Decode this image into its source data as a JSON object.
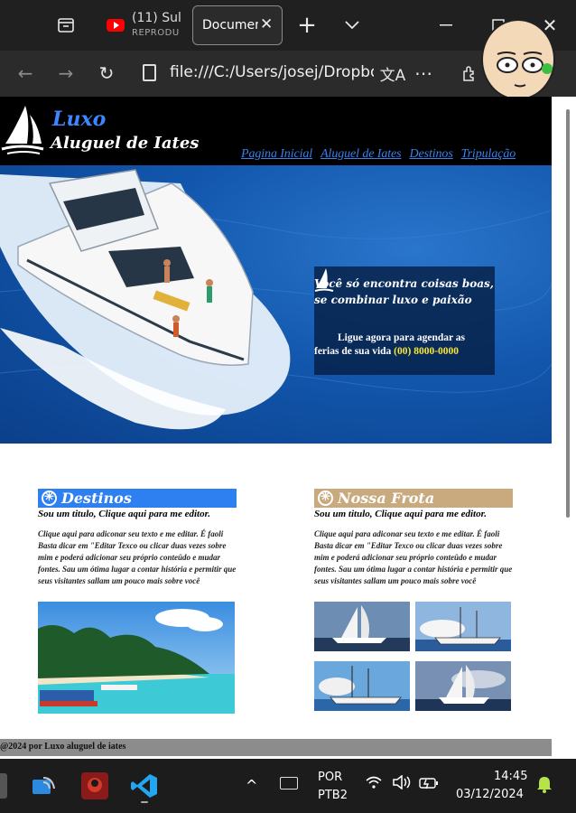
{
  "browser": {
    "tabs": [
      {
        "title": "(11) Sul",
        "subtitle": "REPRODU"
      },
      {
        "title": "Documen",
        "active": true
      }
    ],
    "url": "file:///C:/Users/josej/Dropbox"
  },
  "site": {
    "brand_line1": "Luxo",
    "brand_line2": "Aluguel de Iates",
    "nav": [
      "Pagina Inicial",
      "Aluguel de Iates",
      "Destinos",
      "Tripulação"
    ],
    "hero": {
      "title": "Você só encontra coisas boas, se combinar luxo e paixão",
      "cta_text": "Ligue agora para agendar as ferias de sua vida",
      "phone": "(00) 8000-0000"
    },
    "sections": [
      {
        "title": "Destinos",
        "subtitle": "Sou um titulo, Clique aqui para me editor.",
        "body": "Clique aqui para adiconar seu texto e me editar. É faoli Basta dicar em \"Editar Texco ou clicar duas vezes sobre mim e poderá adicionar seu próprio conteüdo e mudar fontes. Sau um ótima lugar a contar história e permitir que seus visitantes sallam um pouco mais sobre você",
        "header_color": "#2e80f0"
      },
      {
        "title": "Nossa Frota",
        "subtitle": "Sou um titulo, Clique aqui para me editor.",
        "body": "Clique aqui para adiconar seu texto e me editar. É faoli Basta dicar em \"Editar Texco ou clicar duas vezes sobre mim e poderá adicionar seu próprio conteüdo e mudar fontes. Sau um ótima lugar a contar história e permitir que seus visitantes sallam um pouco mais sobre você",
        "header_color": "#c8aa7e"
      }
    ],
    "footer": "@2024 por Luxo aluguel de iates"
  },
  "taskbar": {
    "language": "POR",
    "keyboard": "PTB2",
    "time": "14:45",
    "date": "03/12/2024"
  },
  "colors": {
    "accent_blue": "#3a82e8",
    "phone_yellow": "#f7e637"
  }
}
